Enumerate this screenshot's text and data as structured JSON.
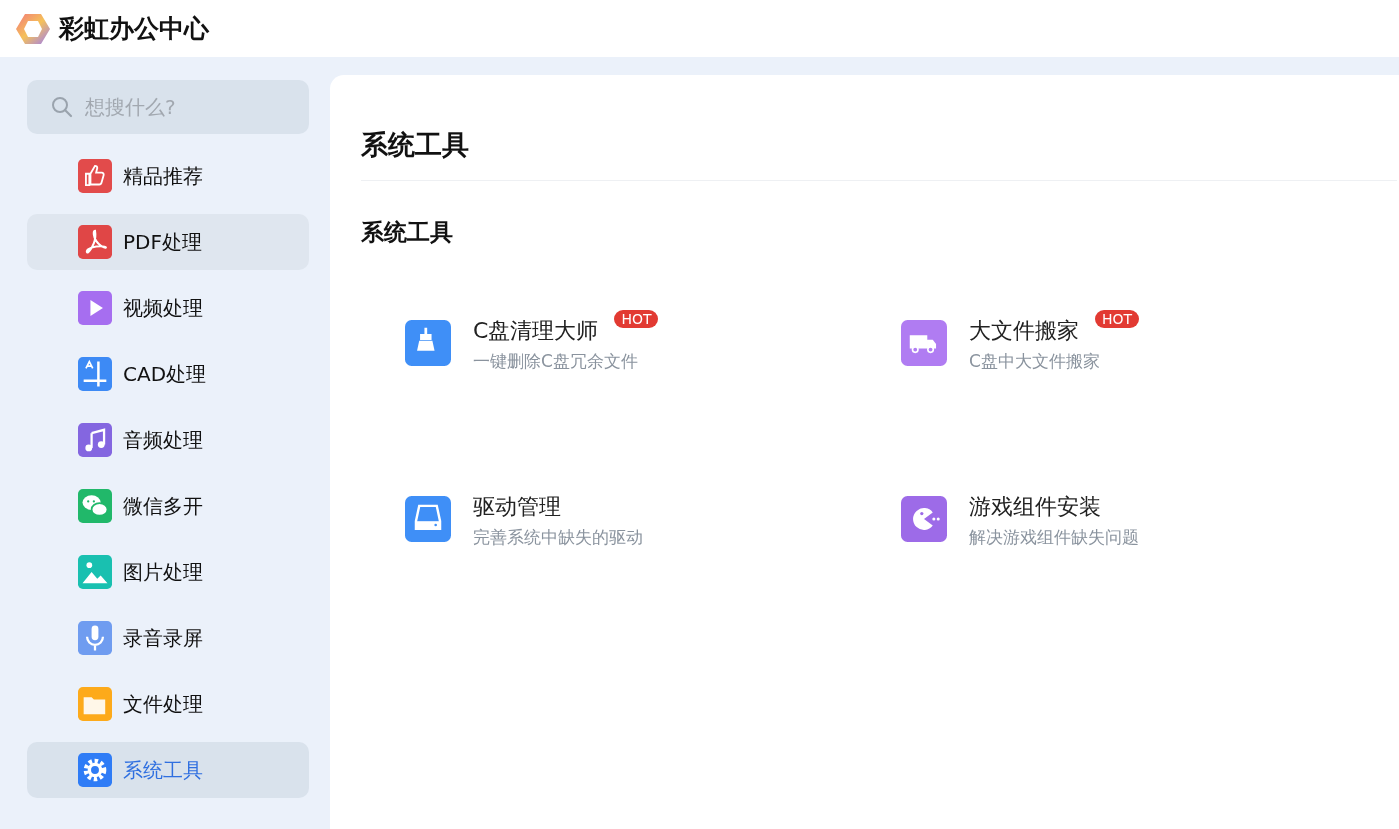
{
  "app": {
    "title": "彩虹办公中心"
  },
  "search": {
    "placeholder": "想搜什么?"
  },
  "sidebar": {
    "items": [
      {
        "label": "精品推荐",
        "kind": "thumb",
        "color": "#e24b4b",
        "selected": false,
        "hovered": false
      },
      {
        "label": "PDF处理",
        "kind": "pdf",
        "color": "#e04646",
        "selected": false,
        "hovered": true
      },
      {
        "label": "视频处理",
        "kind": "play",
        "color": "#a66ef0",
        "selected": false,
        "hovered": false
      },
      {
        "label": "CAD处理",
        "kind": "cad",
        "color": "#3d8af5",
        "selected": false,
        "hovered": false
      },
      {
        "label": "音频处理",
        "kind": "music",
        "color": "#8466e0",
        "selected": false,
        "hovered": false
      },
      {
        "label": "微信多开",
        "kind": "chat",
        "color": "#21b86a",
        "selected": false,
        "hovered": false
      },
      {
        "label": "图片处理",
        "kind": "image",
        "color": "#19c0b0",
        "selected": false,
        "hovered": false
      },
      {
        "label": "录音录屏",
        "kind": "mic",
        "color": "#6f9cf0",
        "selected": false,
        "hovered": false
      },
      {
        "label": "文件处理",
        "kind": "folder",
        "color": "#fdaa1a",
        "selected": false,
        "hovered": false
      },
      {
        "label": "系统工具",
        "kind": "gear",
        "color": "#2f7cf6",
        "selected": true,
        "hovered": false
      }
    ]
  },
  "main": {
    "title": "系统工具",
    "section": "系统工具",
    "tools": [
      {
        "name": "C盘清理大师",
        "description": "一键删除C盘冗余文件",
        "badge": "HOT",
        "kind": "broom",
        "color": "#3f8ff7"
      },
      {
        "name": "大文件搬家",
        "description": "C盘中大文件搬家",
        "badge": "HOT",
        "kind": "truck",
        "color": "#b07cf2"
      },
      {
        "name": "驱动管理",
        "description": "完善系统中缺失的驱动",
        "kind": "drive",
        "color": "#3f8ff7"
      },
      {
        "name": "游戏组件安装",
        "description": "解决游戏组件缺失问题",
        "kind": "pacman",
        "color": "#9d6be8"
      }
    ]
  }
}
